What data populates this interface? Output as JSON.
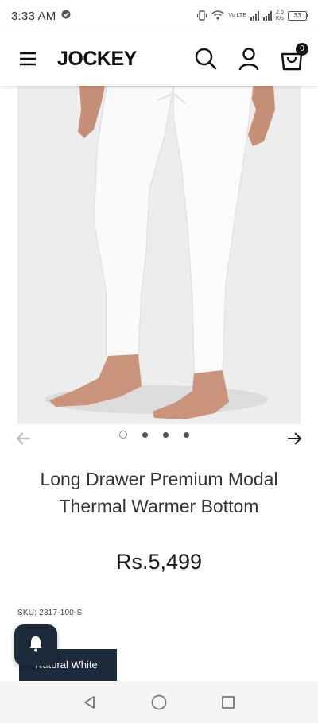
{
  "status_bar": {
    "time": "3:33 AM",
    "network_label": "Vo LTE",
    "speed_value": "2.6",
    "speed_unit": "K/s",
    "battery": "33"
  },
  "header": {
    "logo": "JOCKEY",
    "cart_count": "0"
  },
  "carousel": {
    "dot_count": 4,
    "active_index": 0
  },
  "product": {
    "title": "Long Drawer Premium Modal Thermal Warmer Bottom",
    "price": "Rs.5,499",
    "sku": "SKU: 2317-100-S",
    "color_selected": "Natural White"
  },
  "colors": {
    "accent_dark": "#1c2a3a",
    "image_bg": "#ededed"
  },
  "icons": {
    "menu": "hamburger-icon",
    "search": "search-icon",
    "account": "user-icon",
    "cart": "cart-icon",
    "prev": "arrow-left-icon",
    "next": "arrow-right-icon",
    "bell": "bell-icon",
    "nav_back": "back-triangle-icon",
    "nav_home": "home-circle-icon",
    "nav_recents": "recents-square-icon"
  }
}
